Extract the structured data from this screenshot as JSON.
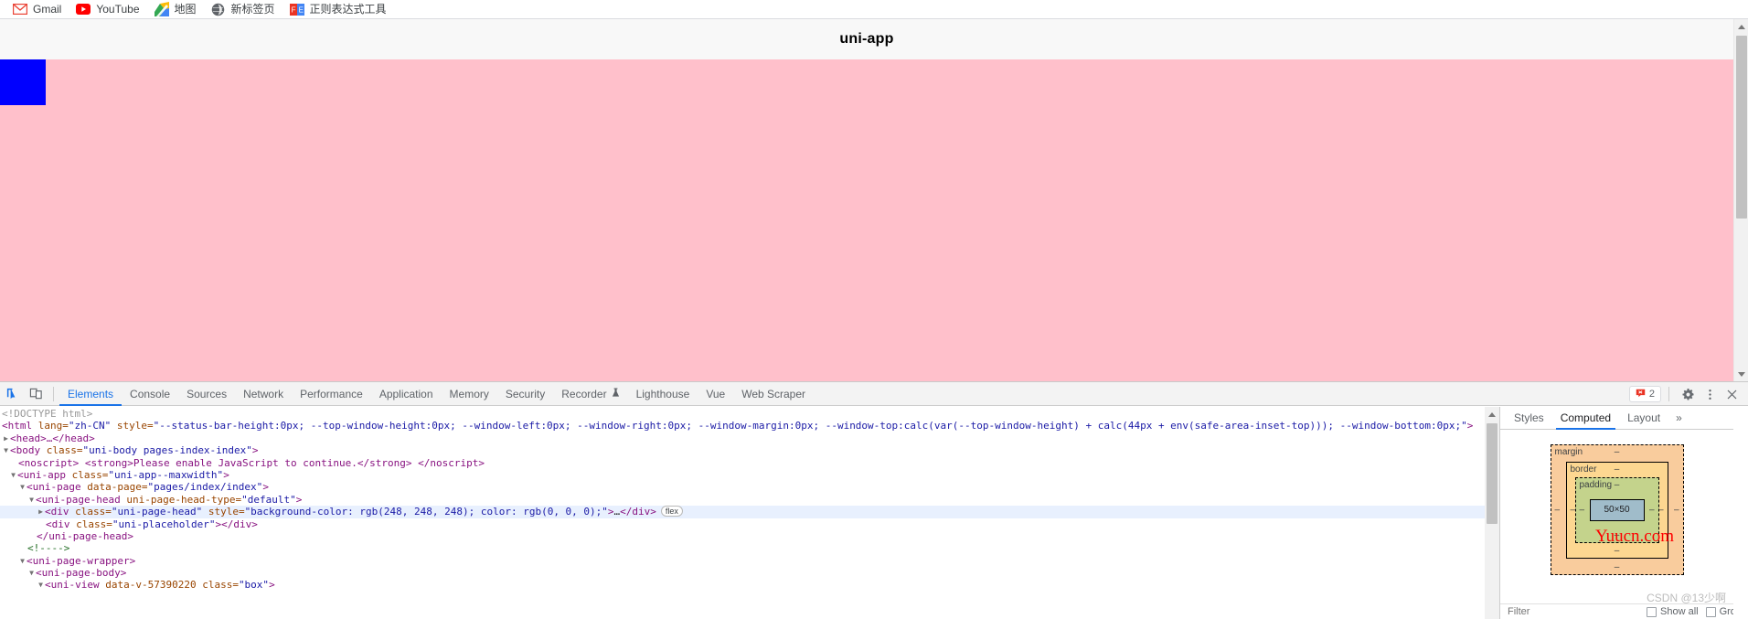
{
  "browser": {
    "bookmarks": [
      {
        "label": "Gmail",
        "icon": "gmail-icon"
      },
      {
        "label": "YouTube",
        "icon": "youtube-icon"
      },
      {
        "label": "地图",
        "icon": "google-maps-icon"
      },
      {
        "label": "新标签页",
        "icon": "globe-icon"
      },
      {
        "label": "正则表达式工具",
        "icon": "regex-tool-icon"
      }
    ]
  },
  "page": {
    "title": "uni-app",
    "head_background": "#f8f8f8",
    "body_background": "#ffc0cb",
    "box_color": "#0000ff"
  },
  "devtools": {
    "tools": [
      {
        "name": "inspect-element-icon",
        "label": "Inspect"
      },
      {
        "name": "device-toolbar-icon",
        "label": "Toggle device toolbar"
      }
    ],
    "tabs": [
      {
        "label": "Elements",
        "active": true
      },
      {
        "label": "Console",
        "active": false
      },
      {
        "label": "Sources",
        "active": false
      },
      {
        "label": "Network",
        "active": false
      },
      {
        "label": "Performance",
        "active": false
      },
      {
        "label": "Application",
        "active": false
      },
      {
        "label": "Memory",
        "active": false
      },
      {
        "label": "Security",
        "active": false
      },
      {
        "label": "Recorder",
        "active": false,
        "icon": "flask-icon"
      },
      {
        "label": "Lighthouse",
        "active": false
      },
      {
        "label": "Vue",
        "active": false
      },
      {
        "label": "Web Scraper",
        "active": false
      }
    ],
    "error_count": "2",
    "right_icons": [
      {
        "name": "settings-gear-icon"
      },
      {
        "name": "more-options-icon"
      },
      {
        "name": "close-devtools-icon"
      }
    ],
    "dom_lines": [
      {
        "doctype": "<!DOCTYPE html>"
      },
      {
        "tag_open": "<html",
        "attrs": [
          {
            "name": " lang=",
            "value": "\"zh-CN\""
          },
          {
            "name": " style=",
            "value": "\"--status-bar-height:0px; --top-window-height:0px; --window-left:0px; --window-right:0px; --window-margin:0px; --window-top:calc(var(--top-window-height) + calc(44px + env(safe-area-inset-top))); --window-bottom:0px;\""
          }
        ],
        "tag_close": ">"
      },
      {
        "collapsed": "<head>…</head>"
      },
      {
        "tag_open": "<body",
        "attrs": [
          {
            "name": " class=",
            "value": "\"uni-body pages-index-index\""
          }
        ],
        "tag_close": ">"
      },
      {
        "noscript": "<noscript> <strong>Please enable JavaScript to continue.</strong> </noscript>"
      },
      {
        "tag_open": "<uni-app",
        "attrs": [
          {
            "name": " class=",
            "value": "\"uni-app--maxwidth\""
          }
        ],
        "tag_close": ">"
      },
      {
        "tag_open": "<uni-page",
        "attrs": [
          {
            "name": " data-page=",
            "value": "\"pages/index/index\""
          }
        ],
        "tag_close": ">"
      },
      {
        "tag_open": "<uni-page-head",
        "attrs": [
          {
            "name": " uni-page-head-type=",
            "value": "\"default\""
          }
        ],
        "tag_close": ">"
      },
      {
        "selected": true,
        "tag_open": "<div",
        "attrs": [
          {
            "name": " class=",
            "value": "\"uni-page-head\""
          },
          {
            "name": " style=",
            "value": "\"background-color: rgb(248, 248, 248); color: rgb(0, 0, 0);\""
          }
        ],
        "tag_close": ">",
        "inner": "…",
        "tag_end": "</div>",
        "badge": "flex"
      },
      {
        "tag_open": "<div",
        "attrs": [
          {
            "name": " class=",
            "value": "\"uni-placeholder\""
          }
        ],
        "tag_close": ">",
        "tag_end": "</div>"
      },
      {
        "tag_end_only": "</uni-page-head>"
      },
      {
        "comment": "<!---->"
      },
      {
        "tag_open": "<uni-page-wrapper",
        "attrs": [],
        "tag_close": ">"
      },
      {
        "tag_open": "<uni-page-body",
        "attrs": [],
        "tag_close": ">"
      },
      {
        "tag_open": "<uni-view",
        "attrs": [
          {
            "name": " data-v-57390220",
            "value": ""
          },
          {
            "name": " class=",
            "value": "\"box\""
          }
        ],
        "tag_close": ">"
      }
    ]
  },
  "sidebar": {
    "tabs": [
      {
        "label": "Styles",
        "active": false
      },
      {
        "label": "Computed",
        "active": true
      },
      {
        "label": "Layout",
        "active": false
      }
    ],
    "more_label": "»",
    "box_model": {
      "margin_label": "margin",
      "margin_top": "–",
      "margin_right": "–",
      "margin_bottom": "–",
      "margin_left": "–",
      "border_label": "border",
      "border_top": "–",
      "border_right": "–",
      "border_bottom": "–",
      "border_left": "–",
      "padding_label": "padding",
      "padding_top": "–",
      "padding_right": "–",
      "padding_bottom": "–",
      "padding_left": "–",
      "content_size": "50×50"
    },
    "filter": {
      "placeholder": "Filter",
      "value": "",
      "show_all_label": "Show all",
      "group_label": "Group"
    }
  },
  "watermarks": {
    "yuucn": "Yuucn.com",
    "csdn": "CSDN @13少啊"
  }
}
